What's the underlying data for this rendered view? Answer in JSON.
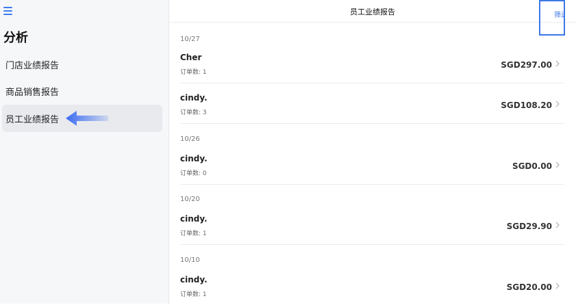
{
  "sidebar": {
    "menu_icon": "hamburger-menu-icon",
    "title": "分析",
    "items": [
      {
        "label": "门店业绩报告"
      },
      {
        "label": "商品销售报告"
      },
      {
        "label": "员工业绩报告",
        "active": true
      }
    ]
  },
  "header": {
    "title": "员工业绩报告",
    "filter_label": "筛选"
  },
  "groups": [
    {
      "date": "10/27",
      "rows": [
        {
          "name": "Cher",
          "orders": "订单数: 1",
          "amount": "SGD297.00"
        },
        {
          "name": "cindy.",
          "orders": "订单数: 3",
          "amount": "SGD108.20"
        }
      ]
    },
    {
      "date": "10/26",
      "rows": [
        {
          "name": "cindy.",
          "orders": "订单数: 0",
          "amount": "SGD0.00"
        }
      ]
    },
    {
      "date": "10/20",
      "rows": [
        {
          "name": "cindy.",
          "orders": "订单数: 1",
          "amount": "SGD29.90"
        }
      ]
    },
    {
      "date": "10/10",
      "rows": [
        {
          "name": "cindy.",
          "orders": "订单数: 1",
          "amount": "SGD20.00"
        }
      ]
    }
  ],
  "colors": {
    "accent": "#3b78e7",
    "sidebar_bg": "#f6f7f9",
    "active_bg": "#e8eaee"
  }
}
